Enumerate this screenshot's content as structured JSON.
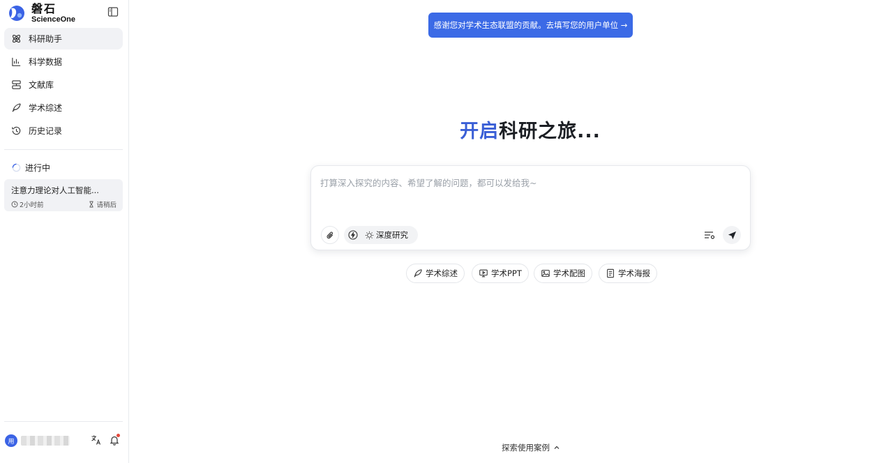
{
  "brand": {
    "name_cn": "磐石",
    "name_en": "ScienceOne",
    "color": "#3b63e5"
  },
  "sidebar": {
    "items": [
      {
        "label": "科研助手",
        "icon": "atom-icon",
        "active": true
      },
      {
        "label": "科学数据",
        "icon": "chart-icon"
      },
      {
        "label": "文献库",
        "icon": "database-icon"
      },
      {
        "label": "学术综述",
        "icon": "feather-pen-icon"
      },
      {
        "label": "历史记录",
        "icon": "history-icon"
      }
    ],
    "in_progress_label": "进行中",
    "task": {
      "title": "注意力理论对人工智能...",
      "time": "2小时前",
      "status": "请稍后"
    },
    "user": {
      "avatar": "用",
      "name": ""
    }
  },
  "banner": {
    "text": "感谢您对学术生态联盟的贡献。去填写您的用户单位 →"
  },
  "headline": {
    "accent": "开启",
    "rest": "科研之旅..."
  },
  "input": {
    "placeholder": "打算深入探究的内容、希望了解的问题，都可以发给我~",
    "mode_label": "深度研究"
  },
  "chips": [
    {
      "label": "学术综述",
      "icon": "feather-pen-icon"
    },
    {
      "label": "学术PPT",
      "icon": "presentation-icon"
    },
    {
      "label": "学术配图",
      "icon": "image-icon"
    },
    {
      "label": "学术海报",
      "icon": "poster-icon"
    }
  ],
  "footer": {
    "explore_label": "探索使用案例"
  },
  "colors": {
    "accent": "#3b6ae6",
    "headline_accent": "#3a5fd6",
    "notification_dot": "#e5483b"
  }
}
